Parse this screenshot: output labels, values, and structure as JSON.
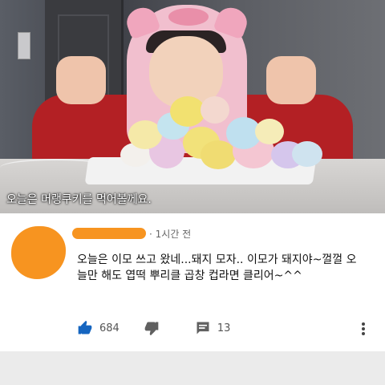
{
  "video": {
    "caption": "오늘은 머랭쿠키를 먹어볼께요."
  },
  "comment": {
    "time": "1시간 전",
    "text": "오늘은 이모 쓰고 왔네...돼지 모자.. 이모가 돼지야~껄껄 오늘만 해도 엽떡 뿌리클 곱창 컵라면 클리어~^^",
    "likes": "684",
    "replies": "13"
  },
  "icons": {
    "like": "thumbs-up-icon",
    "dislike": "thumbs-down-icon",
    "reply": "comment-icon",
    "more": "more-vertical-icon"
  },
  "colors": {
    "accent": "#065fd4",
    "redaction": "#f79420"
  }
}
